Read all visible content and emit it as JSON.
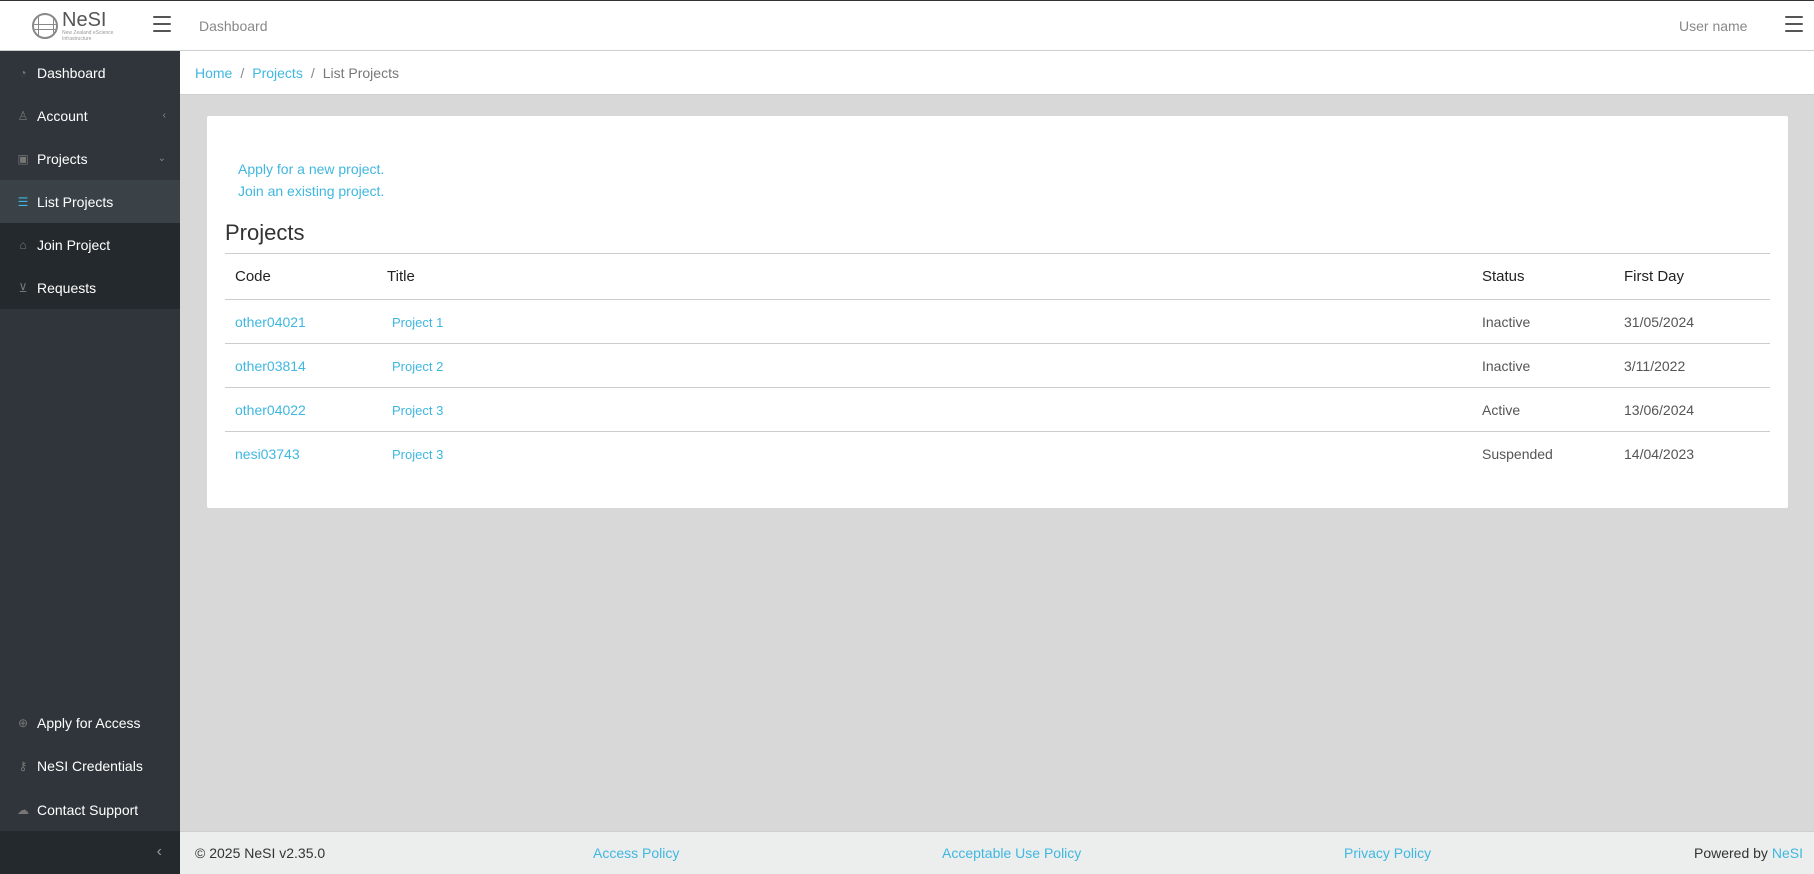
{
  "header": {
    "logo_brand": "NeSI",
    "logo_subtitle": "New Zealand eScience Infrastructure",
    "title": "Dashboard",
    "user": "User name"
  },
  "sidebar": {
    "items": [
      {
        "label": "Dashboard",
        "icon": "gauge-icon"
      },
      {
        "label": "Account",
        "icon": "user-icon"
      },
      {
        "label": "Projects",
        "icon": "briefcase-icon"
      },
      {
        "label": "List Projects",
        "icon": "list-icon"
      },
      {
        "label": "Join Project",
        "icon": "tag-icon"
      },
      {
        "label": "Requests",
        "icon": "cart-icon"
      },
      {
        "label": "Apply for Access",
        "icon": "plus-circle-icon"
      },
      {
        "label": "NeSI Credentials",
        "icon": "key-icon"
      },
      {
        "label": "Contact Support",
        "icon": "cloud-icon"
      }
    ]
  },
  "breadcrumb": {
    "home": "Home",
    "projects": "Projects",
    "current": "List Projects",
    "separator": "/"
  },
  "main": {
    "apply_link": "Apply for a new project.",
    "join_link": "Join an existing project.",
    "heading": "Projects",
    "columns": [
      "Code",
      "Title",
      "Status",
      "First Day"
    ],
    "rows": [
      {
        "code": "other04021",
        "title": "Project 1",
        "status": "Inactive",
        "first_day": "31/05/2024"
      },
      {
        "code": "other03814",
        "title": "Project 2",
        "status": "Inactive",
        "first_day": "3/11/2022"
      },
      {
        "code": "other04022",
        "title": "Project 3",
        "status": "Active",
        "first_day": "13/06/2024"
      },
      {
        "code": "nesi03743",
        "title": "Project 3",
        "status": "Suspended",
        "first_day": "14/04/2023"
      }
    ]
  },
  "footer": {
    "copyright": "© 2025 NeSI v2.35.0",
    "access_policy": "Access Policy",
    "acceptable_use": "Acceptable Use Policy",
    "privacy": "Privacy Policy",
    "powered_by": "Powered by",
    "powered_link": "NeSI"
  },
  "colors": {
    "accent": "#3fb7e0",
    "sidebar_bg": "#2f353a"
  }
}
